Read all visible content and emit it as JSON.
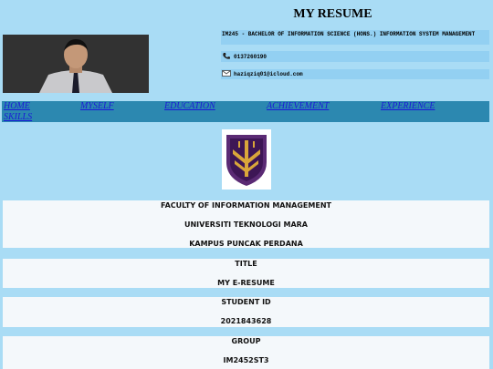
{
  "page": {
    "title": "MY RESUME"
  },
  "profile": {
    "program": "IM245 - BACHELOR OF INFORMATION SCIENCE (HONS.) INFORMATION SYSTEM MANAGEMENT",
    "phone": "0137260190",
    "email": "haziqziq01@icloud.com"
  },
  "nav": {
    "items": [
      "HOME",
      "MYSELF",
      "EDUCATION",
      "ACHIEVEMENT",
      "EXPERIENCE",
      "SKILLS"
    ]
  },
  "cards": {
    "faculty": "FACULTY OF INFORMATION MANAGEMENT",
    "university": "UNIVERSITI TEKNOLOGI MARA",
    "campus": "KAMPUS PUNCAK PERDANA",
    "title_label": "TITLE",
    "title_value": "MY E-RESUME",
    "student_label": "STUDENT ID",
    "student_value": "2021843628",
    "group_label": "GROUP",
    "group_value": "IM2452ST3"
  },
  "colors": {
    "background": "#a9dcf5",
    "navbar": "#2c88b0",
    "link": "#1a1ad6",
    "card": "#f4f8fb"
  }
}
